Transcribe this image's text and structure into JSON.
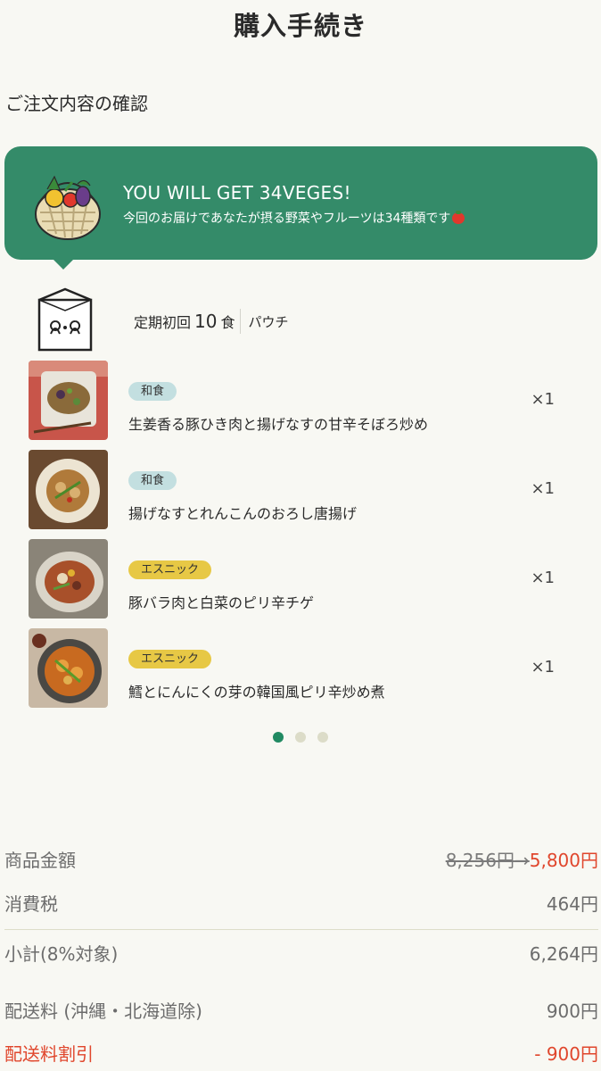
{
  "header": {
    "title": "購入手続き"
  },
  "section": {
    "title": "ご注文内容の確認"
  },
  "banner": {
    "heading": "YOU WILL GET 34VEGES!",
    "text": "今回のお届けであなたが摂る野菜やフルーツは34種類です"
  },
  "plan": {
    "prefix": "定期初回",
    "count": "10",
    "unit": "食",
    "type": "パウチ"
  },
  "items": [
    {
      "tag": "和食",
      "tag_color": "#c3dfe0",
      "name": "生姜香る豚ひき肉と揚げなすの甘辛そぼろ炒め",
      "qty": "×1"
    },
    {
      "tag": "和食",
      "tag_color": "#c3dfe0",
      "name": "揚げなすとれんこんのおろし唐揚げ",
      "qty": "×1"
    },
    {
      "tag": "エスニック",
      "tag_color": "#e7c845",
      "name": "豚バラ肉と白菜のピリ辛チゲ",
      "qty": "×1"
    },
    {
      "tag": "エスニック",
      "tag_color": "#e7c845",
      "name": "鱈とにんにくの芽の韓国風ピリ辛炒め煮",
      "qty": "×1"
    }
  ],
  "pagination": {
    "total": 3,
    "active": 1
  },
  "summary": {
    "subtotal_label": "商品金額",
    "subtotal_original": "8,256円",
    "arrow": "→",
    "subtotal_price": "5,800円",
    "tax_label": "消費税",
    "tax_value": "464円",
    "small_total_label": "小計(8%対象)",
    "small_total_value": "6,264円",
    "shipping_label": "配送料 (沖縄・北海道除)",
    "shipping_value": "900円",
    "discount_label": "配送料割引",
    "discount_value": "- 900円"
  },
  "colors": {
    "accent_green": "#348b69",
    "discount_red": "#e0462c",
    "background": "#f8f8f3"
  }
}
